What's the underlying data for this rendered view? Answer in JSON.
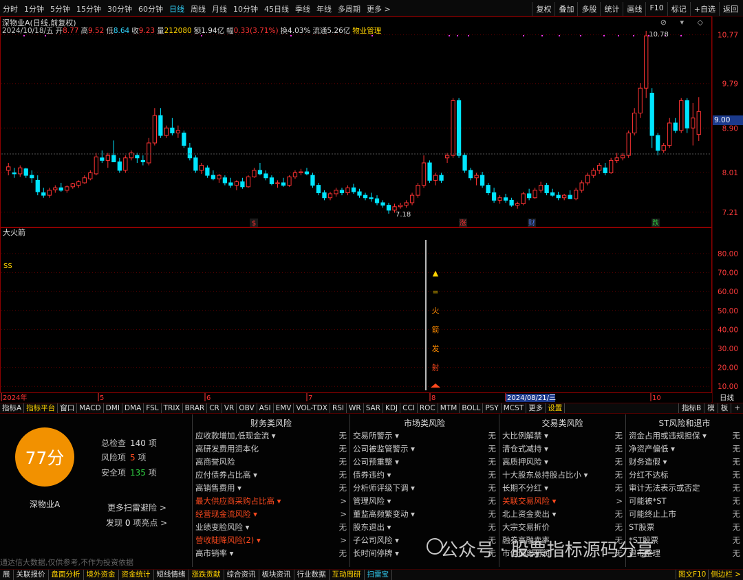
{
  "toolbar": {
    "timeframes": [
      "分时",
      "1分钟",
      "5分钟",
      "15分钟",
      "30分钟",
      "60分钟",
      "日线",
      "周线",
      "月线",
      "10分钟",
      "45日线",
      "季线",
      "年线",
      "多周期",
      "更多 >"
    ],
    "active": "日线",
    "buttons": [
      "复权",
      "叠加",
      "多股",
      "统计",
      "画线",
      "F10",
      "标记",
      "+自选",
      "返回"
    ]
  },
  "header": {
    "title": "深物业A(日线,前复权)",
    "date": "2024/10/18/五",
    "open_label": "开",
    "open": "8.77",
    "high_label": "高",
    "high": "9.52",
    "low_label": "低",
    "low": "8.64",
    "close_label": "收",
    "close": "9.23",
    "vol_label": "量",
    "vol": "212080",
    "amt_label": "额",
    "amt": "1.94亿",
    "chg_label": "幅",
    "chg": "0.33(3.71%)",
    "turn_label": "换",
    "turn": "4.03%",
    "float_label": "流通",
    "float": "5.26亿",
    "industry": "物业管理"
  },
  "price_axis": [
    "10.77",
    "9.79",
    "8.90",
    "8.01",
    "7.21"
  ],
  "current_price": "9.00",
  "annotations": {
    "high": "10.78",
    "low": "7.18"
  },
  "event_markers": [
    "$",
    "涨",
    "财",
    "跌"
  ],
  "indicator": {
    "name": "大火箭",
    "label": "SS",
    "axis": [
      "80.00",
      "70.00",
      "60.00",
      "50.00",
      "40.00",
      "30.00",
      "20.00",
      "10.00"
    ],
    "signal_text": [
      "▲",
      "=",
      "火",
      "箭",
      "发",
      "射"
    ]
  },
  "date_axis": [
    "2024年",
    "5",
    "6",
    "7",
    "8",
    "2024/08/21/三",
    "10"
  ],
  "date_axis_right": "日线",
  "tabs": [
    "指标A",
    "指标平台",
    "窗口",
    "MACD",
    "DMI",
    "DMA",
    "FSL",
    "TRIX",
    "BRAR",
    "CR",
    "VR",
    "OBV",
    "ASI",
    "EMV",
    "VOL-TDX",
    "RSI",
    "WR",
    "SAR",
    "KDJ",
    "CCI",
    "ROC",
    "MTM",
    "BOLL",
    "PSY",
    "MCST",
    "更多",
    "设置"
  ],
  "tabs_right": [
    "指标B",
    "模",
    "板",
    "+"
  ],
  "risk": {
    "score": "77分",
    "stock": "深物业A",
    "total_label": "总检查",
    "total": "140",
    "total_unit": "项",
    "risk_label": "风险项",
    "risk_count": "5",
    "risk_unit": "项",
    "safe_label": "安全项",
    "safe": "135",
    "safe_unit": "项",
    "more_scan": "更多扫雷避险 >",
    "found_prefix": "发现",
    "found": "0",
    "found_suffix": "项亮点 >",
    "disclaimer": "通达信大数据,仅供参考,不作为投资依据",
    "columns": [
      {
        "title": "财务类风险",
        "rows": [
          {
            "name": "应收款增加,低现金流 ▾",
            "value": "无",
            "red": false
          },
          {
            "name": "高研发费用资本化",
            "value": "无",
            "red": false
          },
          {
            "name": "高商誉风险",
            "value": "无",
            "red": false
          },
          {
            "name": "应付债券占比高 ▾",
            "value": "无",
            "red": false
          },
          {
            "name": "高销售费用 ▾",
            "value": "无",
            "red": false
          },
          {
            "name": "最大供应商采购占比高 ▾",
            "value": ">",
            "red": true
          },
          {
            "name": "经营现金流风险 ▾",
            "value": ">",
            "red": true
          },
          {
            "name": "业绩变脸风险 ▾",
            "value": "无",
            "red": false
          },
          {
            "name": "营收陡降风险(2) ▾",
            "value": ">",
            "red": true
          },
          {
            "name": "高市销率 ▾",
            "value": "无",
            "red": false
          }
        ]
      },
      {
        "title": "市场类风险",
        "rows": [
          {
            "name": "交易所警示 ▾",
            "value": "无",
            "red": false
          },
          {
            "name": "公司被监管警示 ▾",
            "value": "无",
            "red": false
          },
          {
            "name": "公司预重整 ▾",
            "value": "无",
            "red": false
          },
          {
            "name": "债券违约 ▾",
            "value": "无",
            "red": false
          },
          {
            "name": "分析师评级下调 ▾",
            "value": "无",
            "red": false
          },
          {
            "name": "管理风险 ▾",
            "value": "无",
            "red": false
          },
          {
            "name": "董监高频繁变动 ▾",
            "value": "无",
            "red": false
          },
          {
            "name": "股东退出 ▾",
            "value": "无",
            "red": false
          },
          {
            "name": "子公司风险 ▾",
            "value": "无",
            "red": false
          },
          {
            "name": "长时间停牌 ▾",
            "value": "无",
            "red": false
          }
        ]
      },
      {
        "title": "交易类风险",
        "rows": [
          {
            "name": "大比例解禁 ▾",
            "value": "无",
            "red": false
          },
          {
            "name": "清仓式减持 ▾",
            "value": "无",
            "red": false
          },
          {
            "name": "高质押风险 ▾",
            "value": "无",
            "red": false
          },
          {
            "name": "十大股东总持股占比小 ▾",
            "value": "无",
            "red": false
          },
          {
            "name": "长期不分红 ▾",
            "value": "无",
            "red": false
          },
          {
            "name": "关联交易风险 ▾",
            "value": ">",
            "red": true
          },
          {
            "name": "北上资金卖出 ▾",
            "value": "无",
            "red": false
          },
          {
            "name": "大宗交易折价",
            "value": "无",
            "red": false
          },
          {
            "name": "融券高融卖率",
            "value": "无",
            "red": false
          },
          {
            "name": "市值偏离利润",
            "value": "无",
            "red": false
          }
        ]
      },
      {
        "title": "ST风险和退市",
        "rows": [
          {
            "name": "资金占用或违规担保 ▾",
            "value": "无",
            "red": false
          },
          {
            "name": "净资产偏低 ▾",
            "value": "无",
            "red": false
          },
          {
            "name": "财务造假 ▾",
            "value": "无",
            "red": false
          },
          {
            "name": "分红不达标",
            "value": "无",
            "red": false
          },
          {
            "name": "审计无法表示或否定",
            "value": "无",
            "red": false
          },
          {
            "name": "可能被*ST",
            "value": "无",
            "red": false
          },
          {
            "name": "可能终止上市",
            "value": "无",
            "red": false
          },
          {
            "name": "ST股票",
            "value": "无",
            "red": false
          },
          {
            "name": "*ST股票",
            "value": "无",
            "red": false
          },
          {
            "name": "退市整理",
            "value": "无",
            "red": false
          }
        ]
      }
    ]
  },
  "statusbar": [
    "展",
    "关联报价",
    "盘面分析",
    "境外资金",
    "资金统计",
    "短线情绪",
    "涨跌贡献",
    "综合资讯",
    "板块资讯",
    "行业数据",
    "互动周研",
    "扫雷宝"
  ],
  "statusbar_right": [
    "图文F10",
    "侧边栏 >"
  ],
  "watermark": "公众号 · 股票指标源码分享",
  "colors": {
    "up": "#ff3333",
    "down": "#00e5ff",
    "accent": "#33d6ff",
    "score": "#f29100",
    "warn": "#ff4a1e"
  },
  "chart_data": {
    "type": "candlestick",
    "title": "深物业A(日线,前复权)",
    "ylim": [
      7.0,
      11.0
    ],
    "yticks": [
      10.77,
      9.79,
      8.9,
      8.01,
      7.21
    ],
    "x": [
      "2024年",
      "5",
      "6",
      "7",
      "8",
      "2024/08/21/三",
      "10"
    ],
    "candles": [
      {
        "o": 8.05,
        "h": 8.2,
        "l": 7.95,
        "c": 8.12
      },
      {
        "o": 8.0,
        "h": 8.1,
        "l": 7.9,
        "c": 7.98
      },
      {
        "o": 7.98,
        "h": 8.15,
        "l": 7.92,
        "c": 8.1
      },
      {
        "o": 8.08,
        "h": 8.1,
        "l": 7.9,
        "c": 7.95
      },
      {
        "o": 7.95,
        "h": 8.05,
        "l": 7.8,
        "c": 7.9
      },
      {
        "o": 7.85,
        "h": 7.95,
        "l": 7.55,
        "c": 7.62
      },
      {
        "o": 7.6,
        "h": 7.7,
        "l": 7.5,
        "c": 7.55
      },
      {
        "o": 7.55,
        "h": 7.7,
        "l": 7.5,
        "c": 7.65
      },
      {
        "o": 7.66,
        "h": 7.75,
        "l": 7.6,
        "c": 7.7
      },
      {
        "o": 7.7,
        "h": 7.8,
        "l": 7.62,
        "c": 7.65
      },
      {
        "o": 7.65,
        "h": 7.75,
        "l": 7.6,
        "c": 7.72
      },
      {
        "o": 7.72,
        "h": 7.8,
        "l": 7.68,
        "c": 7.78
      },
      {
        "o": 7.75,
        "h": 7.85,
        "l": 7.7,
        "c": 7.82
      },
      {
        "o": 7.8,
        "h": 7.95,
        "l": 7.78,
        "c": 7.9
      },
      {
        "o": 7.88,
        "h": 8.05,
        "l": 7.85,
        "c": 8.0
      },
      {
        "o": 7.98,
        "h": 8.4,
        "l": 7.95,
        "c": 8.32
      },
      {
        "o": 8.3,
        "h": 8.45,
        "l": 8.2,
        "c": 8.25
      },
      {
        "o": 8.25,
        "h": 8.4,
        "l": 8.1,
        "c": 8.35
      },
      {
        "o": 8.35,
        "h": 8.65,
        "l": 8.3,
        "c": 8.22
      },
      {
        "o": 8.22,
        "h": 8.3,
        "l": 8.0,
        "c": 8.05
      },
      {
        "o": 8.05,
        "h": 8.35,
        "l": 8.0,
        "c": 8.3
      },
      {
        "o": 8.3,
        "h": 8.45,
        "l": 8.25,
        "c": 8.4
      },
      {
        "o": 8.35,
        "h": 8.4,
        "l": 8.2,
        "c": 8.3
      },
      {
        "o": 8.25,
        "h": 8.35,
        "l": 8.15,
        "c": 8.22
      },
      {
        "o": 8.2,
        "h": 8.7,
        "l": 8.15,
        "c": 8.6
      },
      {
        "o": 8.6,
        "h": 9.3,
        "l": 8.55,
        "c": 9.15
      },
      {
        "o": 9.15,
        "h": 9.3,
        "l": 8.7,
        "c": 8.75
      },
      {
        "o": 8.75,
        "h": 8.95,
        "l": 8.7,
        "c": 8.9
      },
      {
        "o": 8.9,
        "h": 9.1,
        "l": 8.75,
        "c": 8.8
      },
      {
        "o": 8.8,
        "h": 8.95,
        "l": 8.7,
        "c": 8.85
      },
      {
        "o": 8.8,
        "h": 8.85,
        "l": 8.5,
        "c": 8.55
      },
      {
        "o": 8.5,
        "h": 8.6,
        "l": 8.25,
        "c": 8.3
      },
      {
        "o": 8.3,
        "h": 8.35,
        "l": 8.0,
        "c": 8.05
      },
      {
        "o": 8.05,
        "h": 8.2,
        "l": 7.98,
        "c": 8.15
      },
      {
        "o": 8.1,
        "h": 8.15,
        "l": 7.9,
        "c": 7.95
      },
      {
        "o": 7.95,
        "h": 8.05,
        "l": 7.85,
        "c": 7.88
      },
      {
        "o": 7.88,
        "h": 7.98,
        "l": 7.8,
        "c": 7.95
      },
      {
        "o": 7.9,
        "h": 7.95,
        "l": 7.75,
        "c": 7.8
      },
      {
        "o": 7.8,
        "h": 7.9,
        "l": 7.7,
        "c": 7.75
      },
      {
        "o": 7.75,
        "h": 7.85,
        "l": 7.65,
        "c": 7.82
      },
      {
        "o": 7.82,
        "h": 7.9,
        "l": 7.68,
        "c": 7.72
      },
      {
        "o": 7.72,
        "h": 7.95,
        "l": 7.7,
        "c": 7.92
      },
      {
        "o": 7.92,
        "h": 8.1,
        "l": 7.9,
        "c": 8.05
      },
      {
        "o": 8.05,
        "h": 8.2,
        "l": 7.95,
        "c": 7.98
      },
      {
        "o": 7.98,
        "h": 8.05,
        "l": 7.85,
        "c": 7.9
      },
      {
        "o": 7.9,
        "h": 7.95,
        "l": 7.75,
        "c": 7.78
      },
      {
        "o": 7.78,
        "h": 7.85,
        "l": 7.7,
        "c": 7.8
      },
      {
        "o": 7.8,
        "h": 7.9,
        "l": 7.72,
        "c": 7.75
      },
      {
        "o": 7.75,
        "h": 7.95,
        "l": 7.72,
        "c": 7.92
      },
      {
        "o": 7.92,
        "h": 8.05,
        "l": 7.88,
        "c": 8.0
      },
      {
        "o": 8.0,
        "h": 8.08,
        "l": 7.95,
        "c": 8.02
      },
      {
        "o": 8.02,
        "h": 8.1,
        "l": 7.95,
        "c": 7.98
      },
      {
        "o": 7.95,
        "h": 8.0,
        "l": 7.7,
        "c": 7.75
      },
      {
        "o": 7.75,
        "h": 7.8,
        "l": 7.55,
        "c": 7.6
      },
      {
        "o": 7.6,
        "h": 7.65,
        "l": 7.45,
        "c": 7.5
      },
      {
        "o": 7.5,
        "h": 7.62,
        "l": 7.45,
        "c": 7.58
      },
      {
        "o": 7.58,
        "h": 7.7,
        "l": 7.52,
        "c": 7.65
      },
      {
        "o": 7.65,
        "h": 7.7,
        "l": 7.55,
        "c": 7.6
      },
      {
        "o": 7.6,
        "h": 7.75,
        "l": 7.55,
        "c": 7.7
      },
      {
        "o": 7.7,
        "h": 7.78,
        "l": 7.58,
        "c": 7.62
      },
      {
        "o": 7.62,
        "h": 7.68,
        "l": 7.5,
        "c": 7.55
      },
      {
        "o": 7.55,
        "h": 7.6,
        "l": 7.45,
        "c": 7.5
      },
      {
        "o": 7.5,
        "h": 7.6,
        "l": 7.42,
        "c": 7.48
      },
      {
        "o": 7.48,
        "h": 7.55,
        "l": 7.35,
        "c": 7.4
      },
      {
        "o": 7.4,
        "h": 7.45,
        "l": 7.3,
        "c": 7.35
      },
      {
        "o": 7.35,
        "h": 7.4,
        "l": 7.18,
        "c": 7.25
      },
      {
        "o": 7.25,
        "h": 7.38,
        "l": 7.2,
        "c": 7.32
      },
      {
        "o": 7.32,
        "h": 7.4,
        "l": 7.28,
        "c": 7.35
      },
      {
        "o": 7.35,
        "h": 7.45,
        "l": 7.3,
        "c": 7.4
      },
      {
        "o": 7.4,
        "h": 7.6,
        "l": 7.35,
        "c": 7.55
      },
      {
        "o": 7.55,
        "h": 7.8,
        "l": 7.5,
        "c": 7.75
      },
      {
        "o": 7.75,
        "h": 8.35,
        "l": 7.7,
        "c": 8.2
      },
      {
        "o": 8.2,
        "h": 8.25,
        "l": 7.8,
        "c": 7.85
      },
      {
        "o": 7.85,
        "h": 8.0,
        "l": 7.75,
        "c": 7.95
      },
      {
        "o": 7.95,
        "h": 8.0,
        "l": 7.8,
        "c": 7.85
      },
      {
        "o": 8.3,
        "h": 8.4,
        "l": 8.2,
        "c": 8.35
      },
      {
        "o": 8.35,
        "h": 9.5,
        "l": 8.3,
        "c": 9.45
      },
      {
        "o": 9.45,
        "h": 9.5,
        "l": 8.3,
        "c": 8.35
      },
      {
        "o": 8.35,
        "h": 8.4,
        "l": 8.0,
        "c": 8.05
      },
      {
        "o": 8.05,
        "h": 8.1,
        "l": 7.85,
        "c": 7.9
      },
      {
        "o": 7.9,
        "h": 8.0,
        "l": 7.75,
        "c": 7.95
      },
      {
        "o": 7.95,
        "h": 8.02,
        "l": 7.7,
        "c": 7.75
      },
      {
        "o": 7.75,
        "h": 7.8,
        "l": 7.55,
        "c": 7.6
      },
      {
        "o": 7.6,
        "h": 7.7,
        "l": 7.4,
        "c": 7.45
      },
      {
        "o": 7.45,
        "h": 7.55,
        "l": 7.38,
        "c": 7.5
      },
      {
        "o": 7.5,
        "h": 7.58,
        "l": 7.4,
        "c": 7.45
      },
      {
        "o": 7.45,
        "h": 7.5,
        "l": 7.32,
        "c": 7.35
      },
      {
        "o": 7.35,
        "h": 7.42,
        "l": 7.28,
        "c": 7.38
      },
      {
        "o": 7.38,
        "h": 7.62,
        "l": 7.35,
        "c": 7.58
      },
      {
        "o": 7.58,
        "h": 7.68,
        "l": 7.45,
        "c": 7.5
      },
      {
        "o": 7.5,
        "h": 7.7,
        "l": 7.48,
        "c": 7.65
      },
      {
        "o": 7.65,
        "h": 7.82,
        "l": 7.6,
        "c": 7.75
      },
      {
        "o": 7.75,
        "h": 7.8,
        "l": 7.55,
        "c": 7.6
      },
      {
        "o": 7.6,
        "h": 7.68,
        "l": 7.52,
        "c": 7.55
      },
      {
        "o": 7.55,
        "h": 7.62,
        "l": 7.45,
        "c": 7.5
      },
      {
        "o": 7.5,
        "h": 7.58,
        "l": 7.45,
        "c": 7.55
      },
      {
        "o": 7.55,
        "h": 7.65,
        "l": 7.5,
        "c": 7.48
      },
      {
        "o": 7.48,
        "h": 7.7,
        "l": 7.45,
        "c": 7.65
      },
      {
        "o": 7.65,
        "h": 7.85,
        "l": 7.6,
        "c": 7.8
      },
      {
        "o": 7.8,
        "h": 8.0,
        "l": 7.75,
        "c": 7.95
      },
      {
        "o": 7.95,
        "h": 8.1,
        "l": 7.9,
        "c": 8.05
      },
      {
        "o": 8.05,
        "h": 8.2,
        "l": 7.98,
        "c": 8.15
      },
      {
        "o": 8.1,
        "h": 8.2,
        "l": 7.95,
        "c": 8.0
      },
      {
        "o": 8.0,
        "h": 8.3,
        "l": 7.98,
        "c": 8.25
      },
      {
        "o": 8.25,
        "h": 8.4,
        "l": 8.2,
        "c": 8.3
      },
      {
        "o": 8.3,
        "h": 8.4,
        "l": 8.25,
        "c": 8.35
      },
      {
        "o": 8.35,
        "h": 8.85,
        "l": 8.3,
        "c": 8.8
      },
      {
        "o": 8.8,
        "h": 9.3,
        "l": 8.75,
        "c": 9.2
      },
      {
        "o": 9.2,
        "h": 9.8,
        "l": 9.1,
        "c": 9.7
      },
      {
        "o": 9.7,
        "h": 10.85,
        "l": 9.5,
        "c": 10.75
      },
      {
        "o": 9.6,
        "h": 9.7,
        "l": 8.5,
        "c": 8.75
      },
      {
        "o": 8.75,
        "h": 8.8,
        "l": 8.35,
        "c": 8.45
      },
      {
        "o": 8.45,
        "h": 8.6,
        "l": 8.4,
        "c": 8.55
      },
      {
        "o": 8.55,
        "h": 9.1,
        "l": 8.5,
        "c": 9.0
      },
      {
        "o": 9.0,
        "h": 9.1,
        "l": 8.8,
        "c": 8.85
      },
      {
        "o": 8.85,
        "h": 9.5,
        "l": 8.8,
        "c": 9.45
      },
      {
        "o": 9.45,
        "h": 9.5,
        "l": 8.8,
        "c": 8.9
      },
      {
        "o": 8.9,
        "h": 9.4,
        "l": 8.55,
        "c": 9.1
      },
      {
        "o": 8.77,
        "h": 9.52,
        "l": 8.64,
        "c": 9.23
      }
    ]
  }
}
